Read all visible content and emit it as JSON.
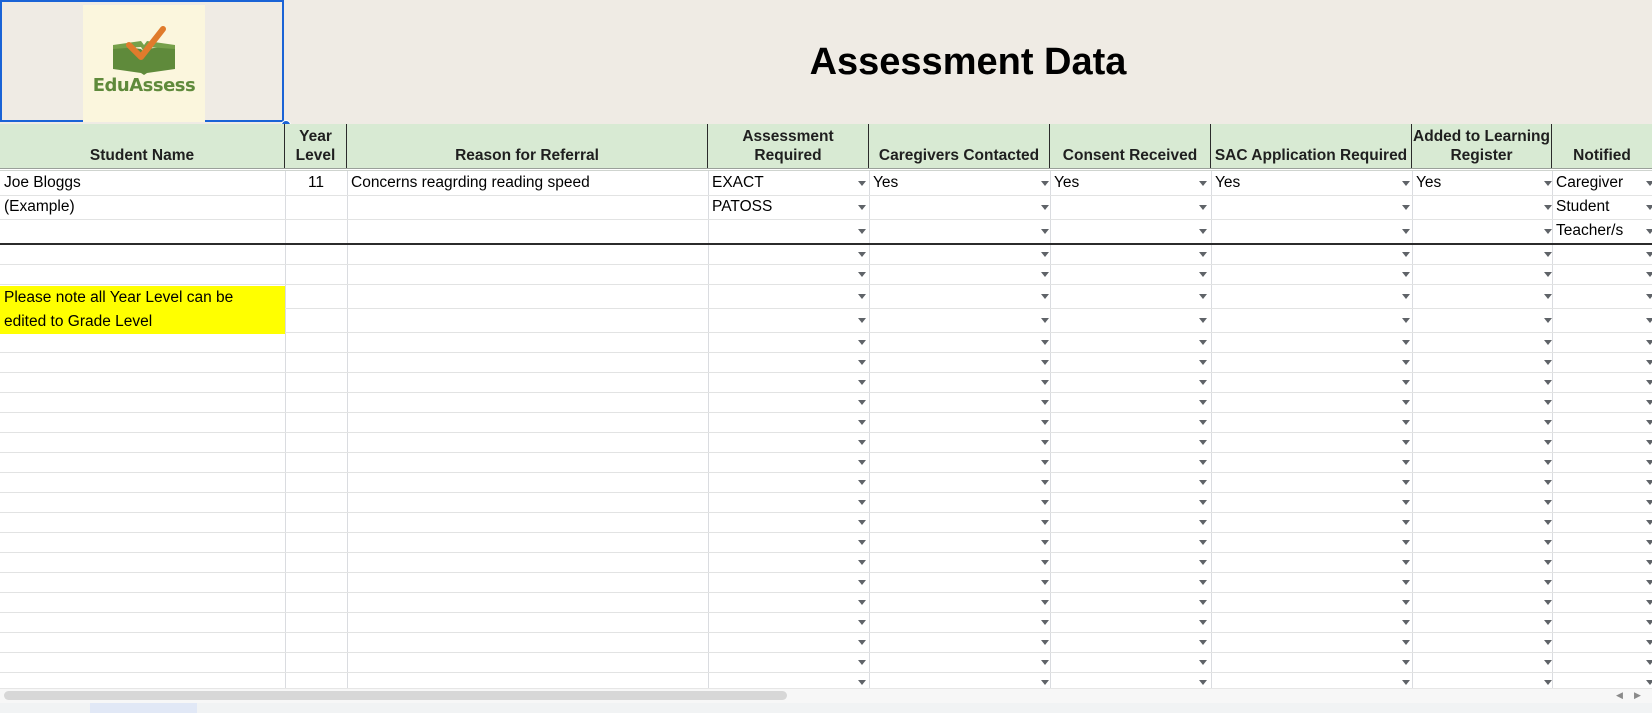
{
  "sheet": {
    "title": "Assessment Data",
    "logo_text": "EduAssess",
    "columns": [
      {
        "key": "student",
        "label": "Student Name"
      },
      {
        "key": "year",
        "label": "Year Level"
      },
      {
        "key": "reason",
        "label": "Reason for Referral"
      },
      {
        "key": "assessment",
        "label": "Assessment Required"
      },
      {
        "key": "caregivers",
        "label": "Caregivers Contacted"
      },
      {
        "key": "consent",
        "label": "Consent Received"
      },
      {
        "key": "sac",
        "label": "SAC Application Required"
      },
      {
        "key": "learning",
        "label": "Added to Learning Register"
      },
      {
        "key": "notified",
        "label": "Notified"
      }
    ],
    "example": {
      "student_line1": "Joe Bloggs",
      "student_line2": "(Example)",
      "year": "11",
      "reason": "Concerns reagrding reading speed",
      "assessment": [
        "EXACT",
        "PATOSS"
      ],
      "caregivers": "Yes",
      "consent": "Yes",
      "sac": "Yes",
      "learning": "Yes",
      "notified": [
        "Caregiver",
        "Student",
        "Teacher/s"
      ]
    },
    "note": {
      "line1": "Please note all Year Level can be",
      "line2": "edited to Grade Level"
    },
    "colors": {
      "header_bg": "#d8ead3",
      "banner_bg": "#efebe4",
      "note_bg": "#ffff00",
      "logo_green": "#5f8a3b",
      "logo_check": "#e07b2c",
      "selection": "#1a63d6"
    },
    "icons": {
      "dropdown": "chevron-down-icon",
      "logo": "book-check-icon"
    }
  }
}
